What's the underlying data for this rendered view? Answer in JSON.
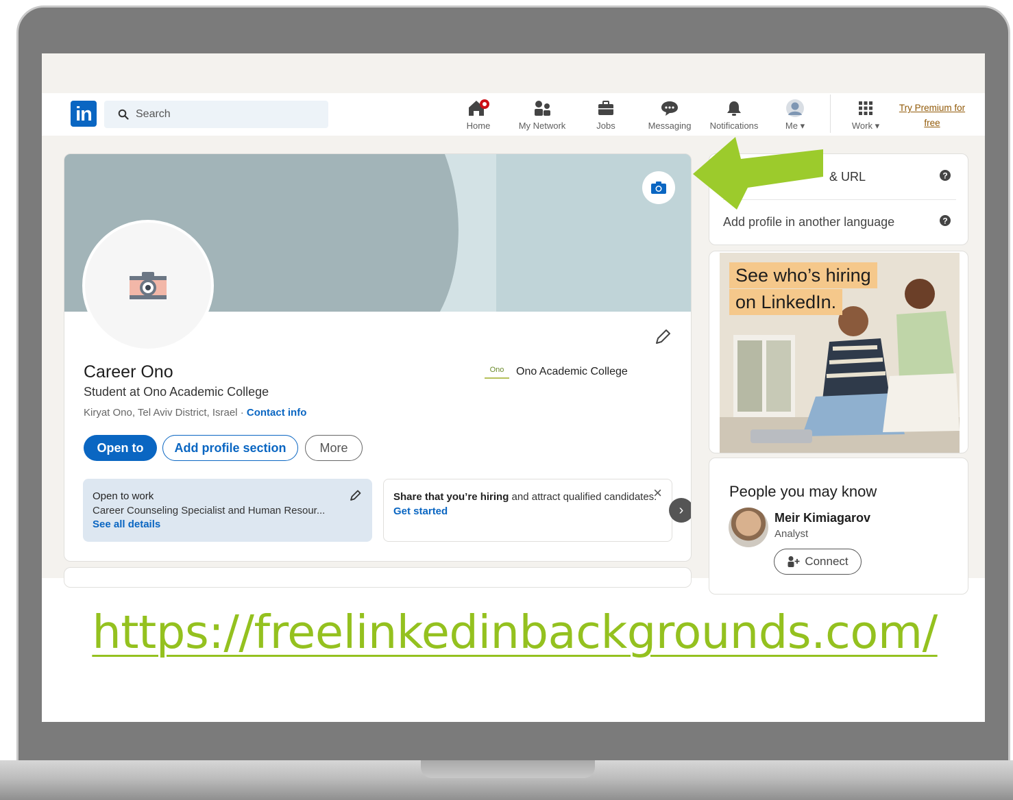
{
  "nav": {
    "logo": "in",
    "search_placeholder": "Search",
    "items": [
      {
        "label": "Home",
        "icon": "home-icon"
      },
      {
        "label": "My Network",
        "icon": "network-icon"
      },
      {
        "label": "Jobs",
        "icon": "briefcase-icon"
      },
      {
        "label": "Messaging",
        "icon": "message-icon"
      },
      {
        "label": "Notifications",
        "icon": "bell-icon"
      },
      {
        "label": "Me",
        "icon": "avatar-icon"
      },
      {
        "label": "Work",
        "icon": "grid-icon"
      }
    ],
    "premium_line1": "Try Premium for",
    "premium_line2": "free"
  },
  "profile": {
    "name": "Career Ono",
    "headline": "Student at Ono Academic College",
    "location": "Kiryat Ono, Tel Aviv District, Israel",
    "location_sep": " · ",
    "contact_link": "Contact info",
    "school": "Ono Academic College",
    "school_logo_text": "Ono",
    "buttons": {
      "open_to": "Open to",
      "add_section": "Add profile section",
      "more": "More"
    }
  },
  "open_to_work": {
    "title": "Open to work",
    "roles": "Career Counseling Specialist and Human Resour...",
    "link": "See all details"
  },
  "hiring": {
    "bold": "Share that you’re hiring",
    "rest": " and attract qualified candidates.",
    "link": "Get started",
    "close": "×"
  },
  "sidebar": {
    "url_row": "& URL",
    "language_row": "Add profile in another language",
    "ad_line1": "See who’s hiring",
    "ad_line2": "on LinkedIn.",
    "pymk_title": "People you may know",
    "person_name": "Meir Kimiagarov",
    "person_role": "Analyst",
    "connect": "Connect"
  },
  "caption_url": "https://freelinkedinbackgrounds.com/",
  "colors": {
    "linkedin_blue": "#0a66c2",
    "arrow_green": "#9ccb2c",
    "url_green": "#94c11f",
    "banner_teal": "#bfd2d5",
    "notification_red": "#cc1016"
  }
}
